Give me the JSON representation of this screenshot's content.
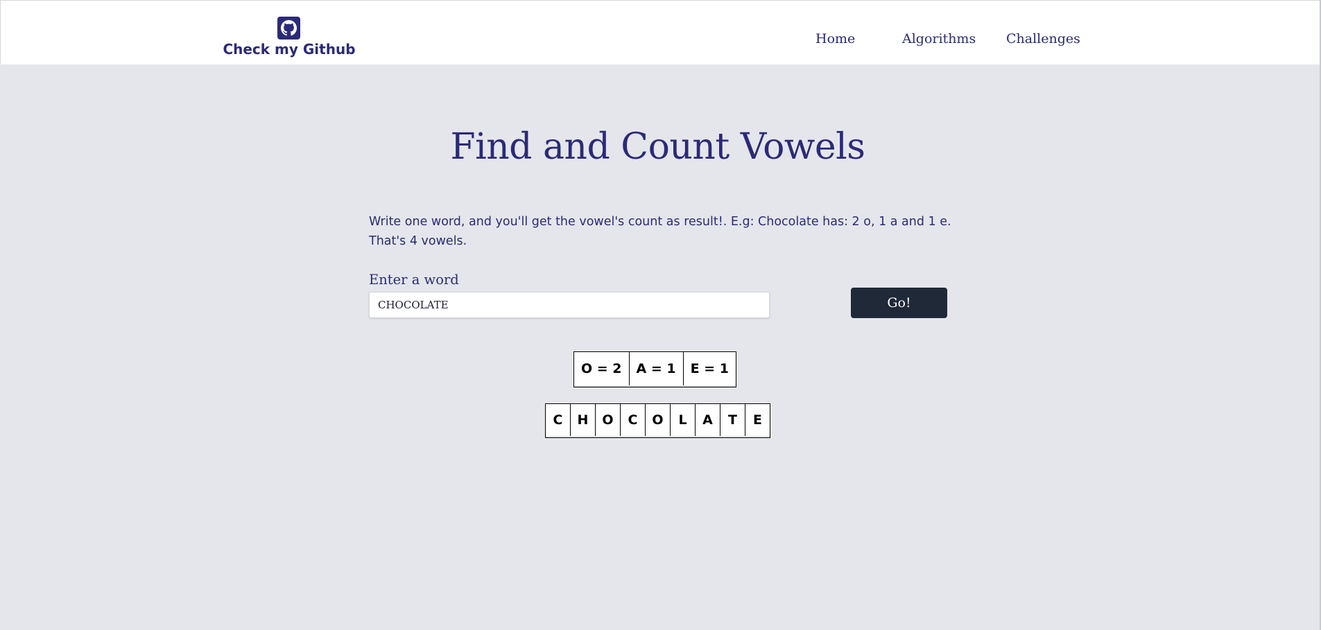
{
  "header": {
    "github_label": "Check my Github",
    "github_icon": "github-icon",
    "nav": [
      {
        "label": "Home"
      },
      {
        "label": "Algorithms"
      },
      {
        "label": "Challenges"
      }
    ]
  },
  "main": {
    "title": "Find and Count Vowels",
    "description": "Write one word, and you'll get the vowel's count as result!. E.g: Chocolate has: 2 o, 1 a and 1 e. That's 4 vowels.",
    "input_label": "Enter a word",
    "input_value": "CHOCOLATE",
    "go_label": "Go!",
    "vowel_counts": [
      "O = 2",
      "A = 1",
      "E = 1"
    ],
    "letters": [
      "C",
      "H",
      "O",
      "C",
      "O",
      "L",
      "A",
      "T",
      "E"
    ]
  },
  "colors": {
    "primary": "#2b2a78",
    "background": "#e5e6eb",
    "button": "#1f2937"
  }
}
